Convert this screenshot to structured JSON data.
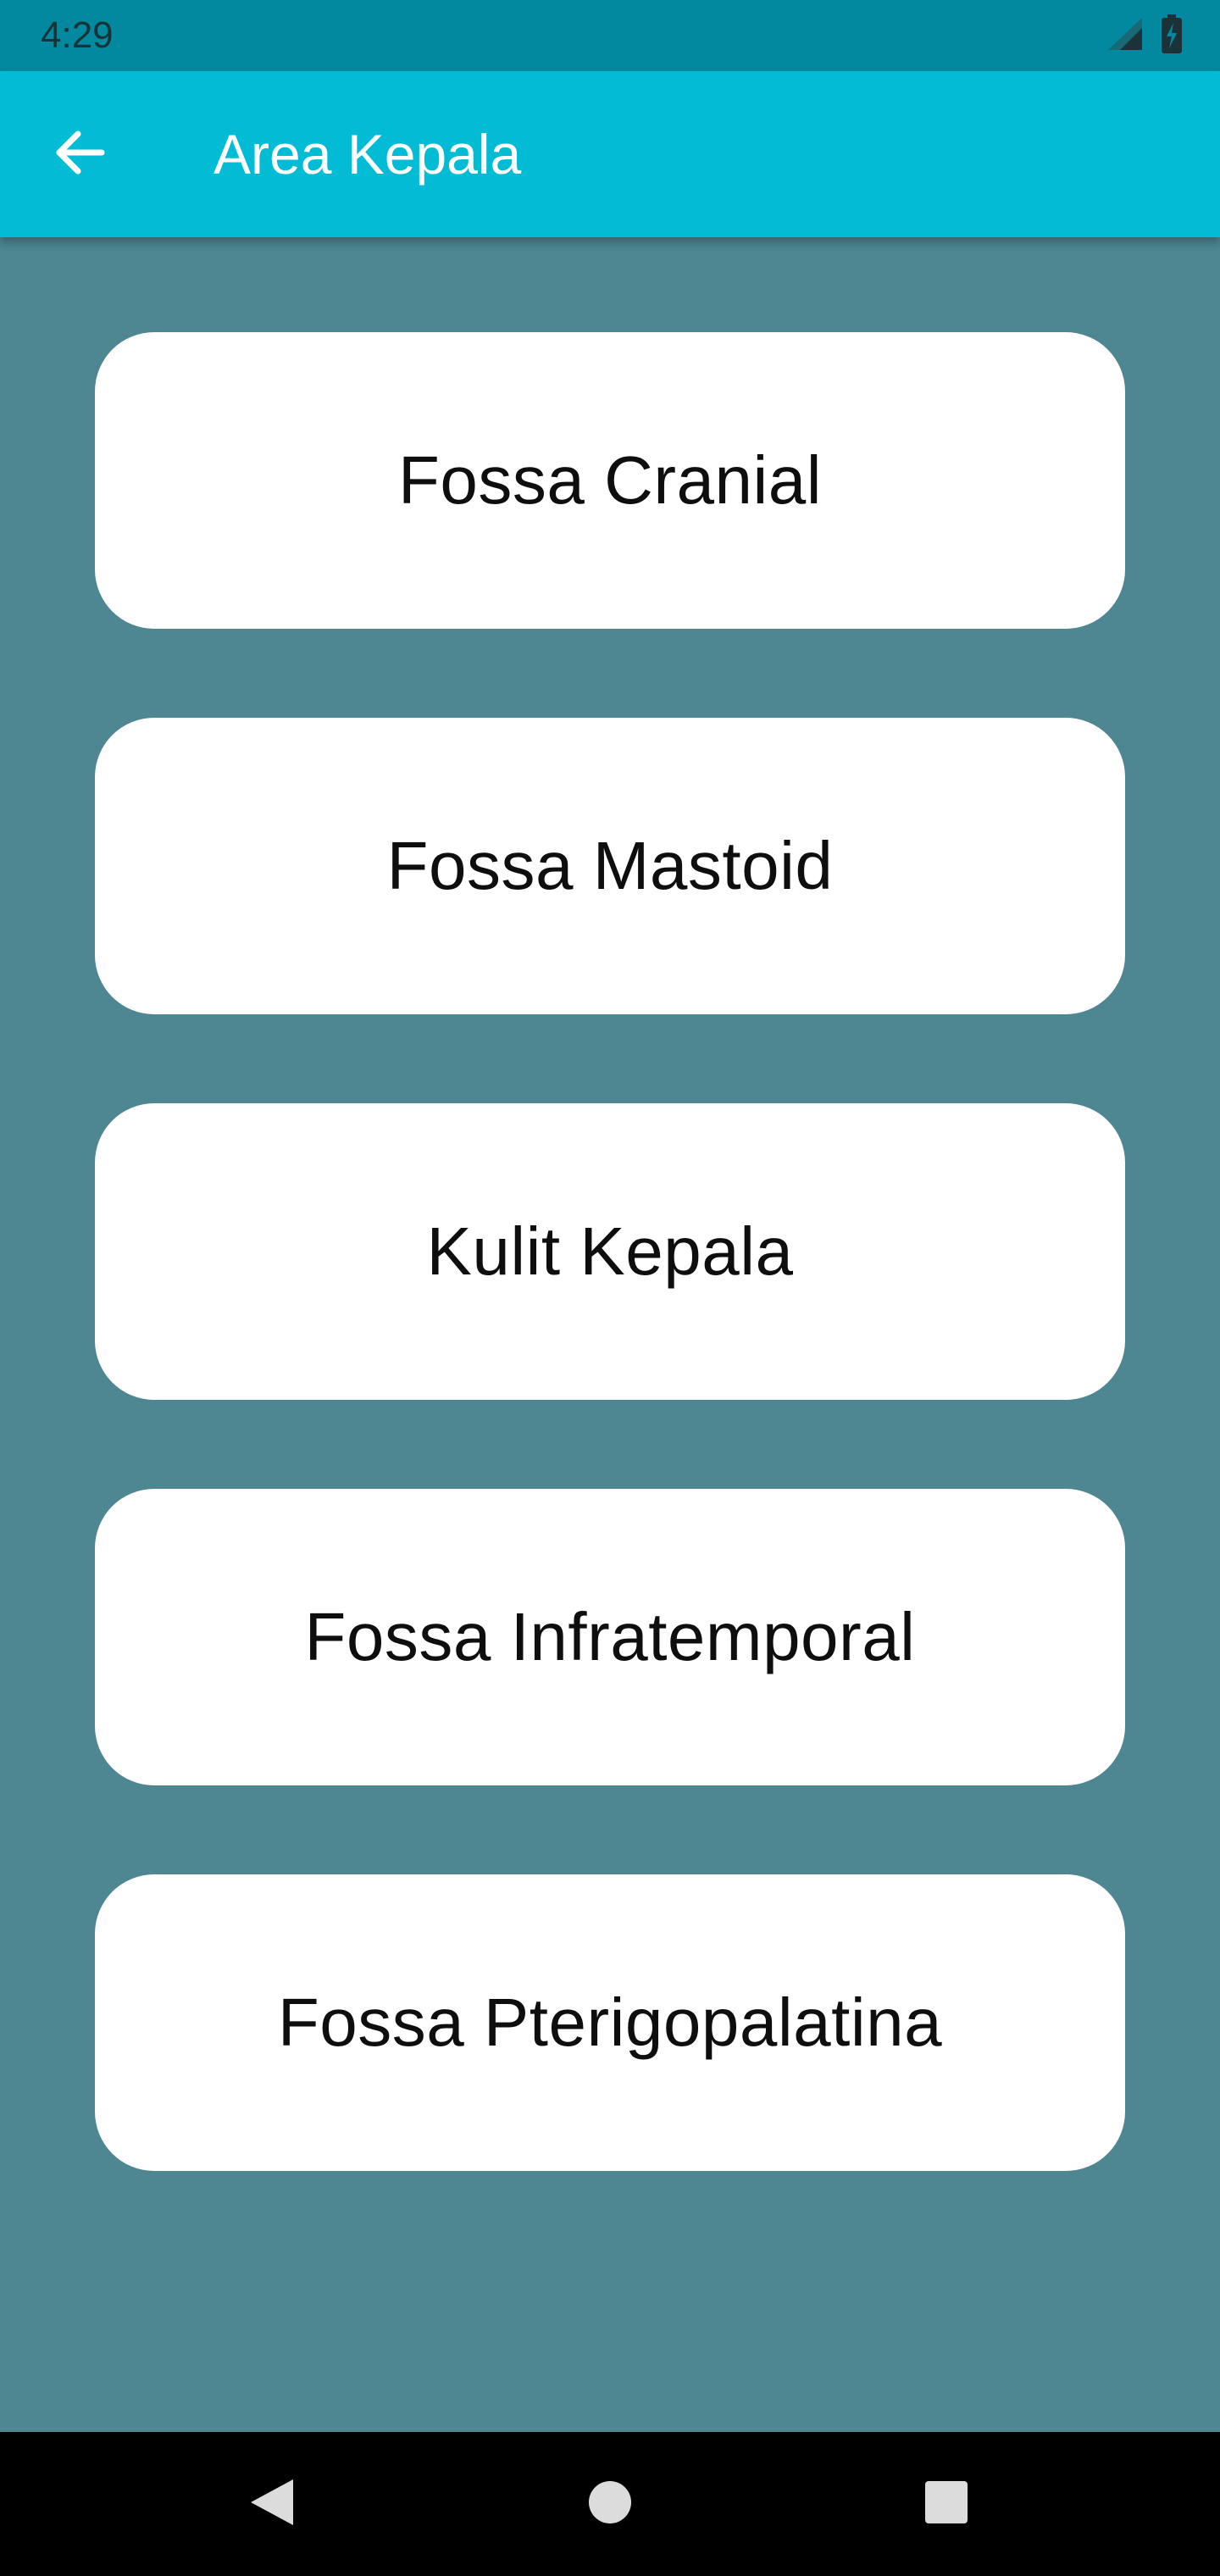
{
  "status_bar": {
    "time": "4:29"
  },
  "app_bar": {
    "title": "Area Kepala",
    "back_icon": "arrow-back-icon"
  },
  "menu": {
    "items": [
      {
        "label": "Fossa Cranial"
      },
      {
        "label": "Fossa Mastoid"
      },
      {
        "label": "Kulit Kepala"
      },
      {
        "label": "Fossa Infratemporal"
      },
      {
        "label": "Fossa Pterigopalatina"
      }
    ]
  },
  "nav_bar": {
    "icons": [
      "back-triangle-icon",
      "home-circle-icon",
      "recents-square-icon"
    ]
  },
  "colors": {
    "status_bar": "#02899f",
    "app_bar": "#02bcd6",
    "background": "#4e8692",
    "card": "#ffffff",
    "nav_bar": "#000000"
  }
}
